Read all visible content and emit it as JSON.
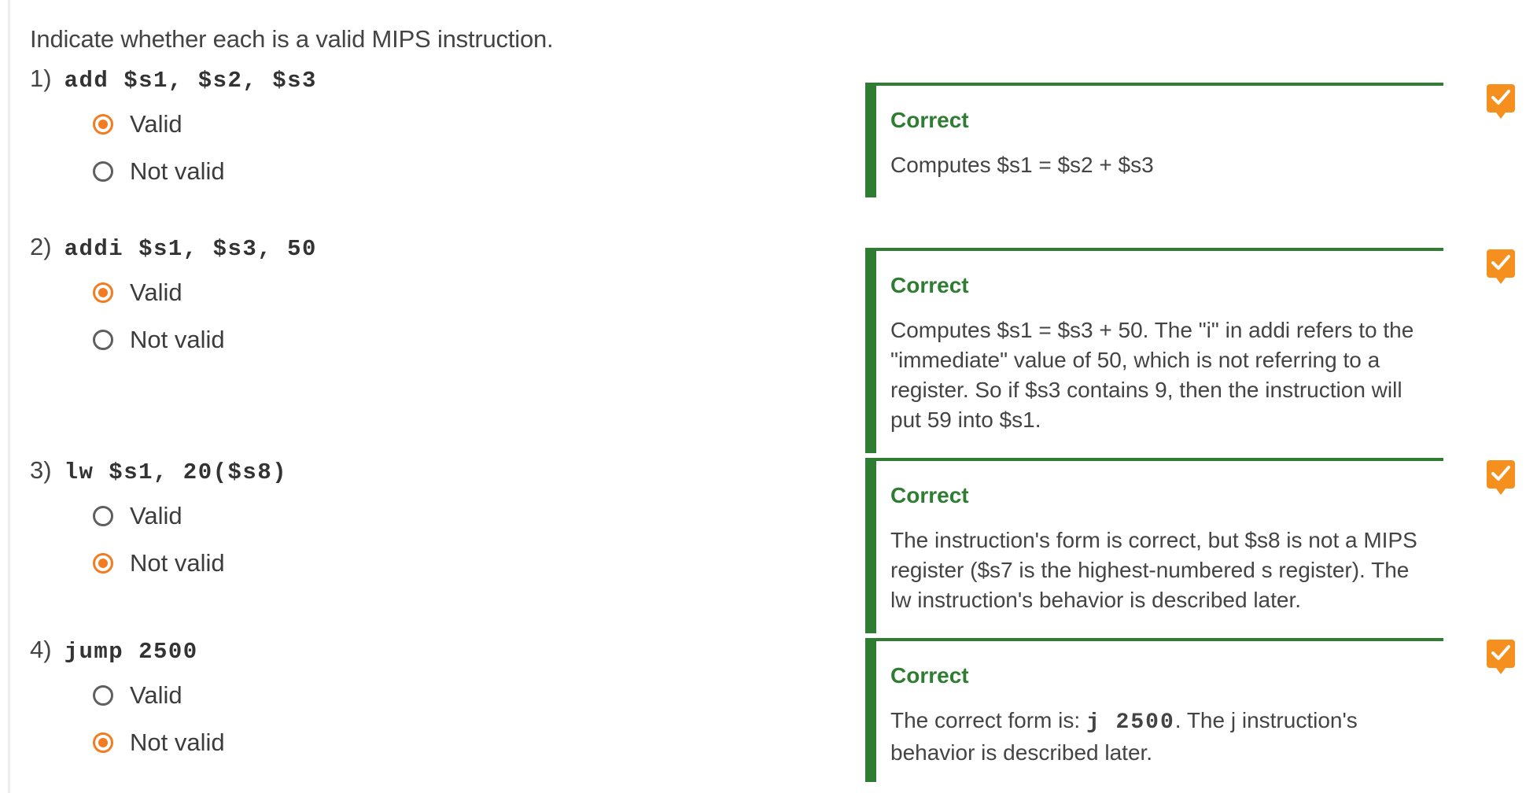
{
  "prompt": "Indicate whether each is a valid MIPS instruction.",
  "questions": [
    {
      "number": "1)",
      "code": "add $s1, $s2, $s3",
      "options": [
        "Valid",
        "Not valid"
      ],
      "selected": "Valid",
      "feedback_title": "Correct",
      "feedback_text": "Computes $s1 = $s2 + $s3"
    },
    {
      "number": "2)",
      "code": "addi $s1, $s3, 50",
      "options": [
        "Valid",
        "Not valid"
      ],
      "selected": "Valid",
      "feedback_title": "Correct",
      "feedback_text": "Computes $s1 = $s3 + 50. The \"i\" in addi refers to the \"immediate\" value of 50, which is not referring to a register. So if $s3 contains 9, then the instruction will put 59 into $s1."
    },
    {
      "number": "3)",
      "code": "lw $s1, 20($s8)",
      "options": [
        "Valid",
        "Not valid"
      ],
      "selected": "Not valid",
      "feedback_title": "Correct",
      "feedback_text": "The instruction's form is correct, but $s8 is not a MIPS register ($s7 is the highest-numbered s register). The lw instruction's behavior is described later."
    },
    {
      "number": "4)",
      "code": "jump 2500",
      "options": [
        "Valid",
        "Not valid"
      ],
      "selected": "Not valid",
      "feedback_title": "Correct",
      "feedback_text_before": "The correct form is: ",
      "feedback_code": "j 2500",
      "feedback_text_after": ". The j instruction's behavior is described later."
    }
  ],
  "colors": {
    "accent": "#f47c20",
    "correct": "#2e7d32",
    "badge": "#f5901e"
  },
  "icons": [
    "checkmark-icon"
  ]
}
